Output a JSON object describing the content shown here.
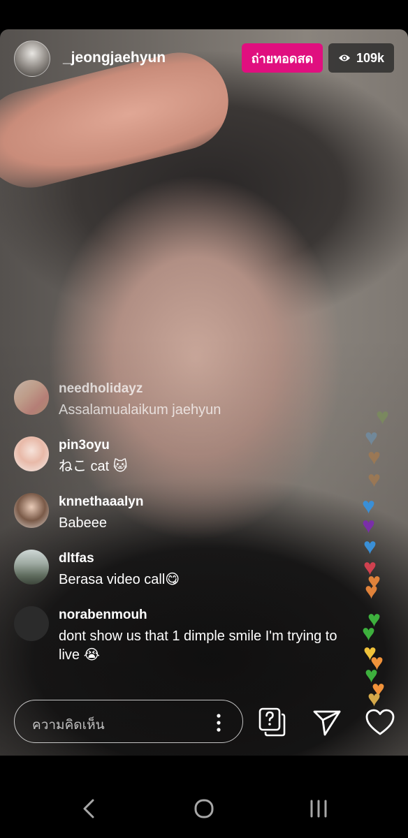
{
  "header": {
    "username": "_jeongjaehyun",
    "live_label": "ถ่ายทอดสด",
    "viewer_count": "109k"
  },
  "comments": [
    {
      "user": "needholidayz",
      "text": "Assalamualaikum jaehyun"
    },
    {
      "user": "pin3oyu",
      "text": "ねこ cat 🐱"
    },
    {
      "user": "knnethaaalyn",
      "text": "Babeee"
    },
    {
      "user": "dltfas",
      "text": "Berasa video call😋"
    },
    {
      "user": "norabenmouh",
      "text": "dont show us that 1 dimple smile I'm trying to live 😭"
    }
  ],
  "composer": {
    "placeholder": "ความคิดเห็น"
  },
  "hearts": {
    "colors": [
      "#7a8f5a",
      "#6f8fa8",
      "#a57a4e",
      "#a57a4e",
      "#3a8fd6",
      "#7a2fa8",
      "#3a8fd6",
      "#d0414f",
      "#e0823a",
      "#e0823a",
      "#3db03d",
      "#3db03d",
      "#f0c23a",
      "#f0923a",
      "#3db03d",
      "#f0923a",
      "#d4a84a"
    ]
  },
  "icons": {
    "viewer": "eye-icon",
    "more": "more-vertical-icon",
    "questions": "question-cards-icon",
    "share": "send-icon",
    "like": "heart-outline-icon",
    "nav_back": "chevron-left-icon",
    "nav_home": "home-circle-icon",
    "nav_recents": "recents-icon"
  }
}
